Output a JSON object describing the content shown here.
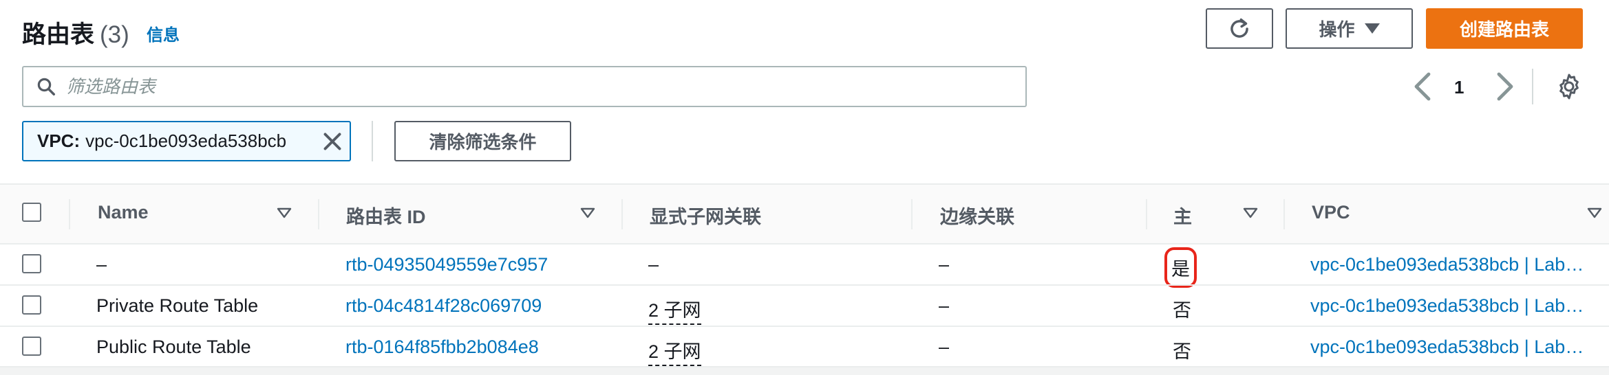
{
  "header": {
    "title": "路由表",
    "count": "(3)",
    "info_link": "信息",
    "actions_label": "操作",
    "create_label": "创建路由表"
  },
  "search": {
    "placeholder": "筛选路由表",
    "value": ""
  },
  "pagination": {
    "current_page": "1"
  },
  "filter": {
    "token_key": "VPC:",
    "token_value": "vpc-0c1be093eda538bcb",
    "clear_label": "清除筛选条件"
  },
  "table": {
    "columns": [
      "Name",
      "路由表 ID",
      "显式子网关联",
      "边缘关联",
      "主",
      "VPC"
    ],
    "rows": [
      {
        "name": "–",
        "id": "rtb-04935049559e7c957",
        "subnet_assoc": "–",
        "edge_assoc": "–",
        "main": "是",
        "vpc": "vpc-0c1be093eda538bcb | Lab…"
      },
      {
        "name": "Private Route Table",
        "id": "rtb-04c4814f28c069709",
        "subnet_assoc": "2 子网",
        "edge_assoc": "–",
        "main": "否",
        "vpc": "vpc-0c1be093eda538bcb | Lab…"
      },
      {
        "name": "Public Route Table",
        "id": "rtb-0164f85fbb2b084e8",
        "subnet_assoc": "2 子网",
        "edge_assoc": "–",
        "main": "否",
        "vpc": "vpc-0c1be093eda538bcb | Lab…"
      }
    ]
  },
  "colors": {
    "link": "#0073bb",
    "primary_button": "#ec7211",
    "highlight": "#e8251a"
  },
  "icons": {
    "refresh": "refresh-icon",
    "search": "search-icon",
    "settings": "gear-icon",
    "clear_token": "close-icon",
    "sort": "sort-caret-icon"
  }
}
